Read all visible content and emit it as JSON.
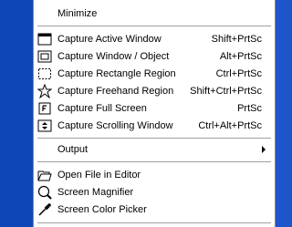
{
  "menu": {
    "minimize": "Minimize",
    "capture_items": [
      {
        "label": "Capture Active Window",
        "shortcut": "Shift+PrtSc",
        "icon": "active-window-icon"
      },
      {
        "label": "Capture Window / Object",
        "shortcut": "Alt+PrtSc",
        "icon": "window-object-icon"
      },
      {
        "label": "Capture Rectangle Region",
        "shortcut": "Ctrl+PrtSc",
        "icon": "rectangle-region-icon"
      },
      {
        "label": "Capture Freehand Region",
        "shortcut": "Shift+Ctrl+PrtSc",
        "icon": "freehand-region-icon"
      },
      {
        "label": "Capture Full Screen",
        "shortcut": "PrtSc",
        "icon": "full-screen-icon"
      },
      {
        "label": "Capture Scrolling Window",
        "shortcut": "Ctrl+Alt+PrtSc",
        "icon": "scrolling-window-icon"
      }
    ],
    "output": "Output",
    "tools": [
      {
        "label": "Open File in Editor",
        "icon": "open-folder-icon"
      },
      {
        "label": "Screen Magnifier",
        "icon": "magnifier-icon"
      },
      {
        "label": "Screen Color Picker",
        "icon": "eyedropper-icon"
      }
    ]
  }
}
